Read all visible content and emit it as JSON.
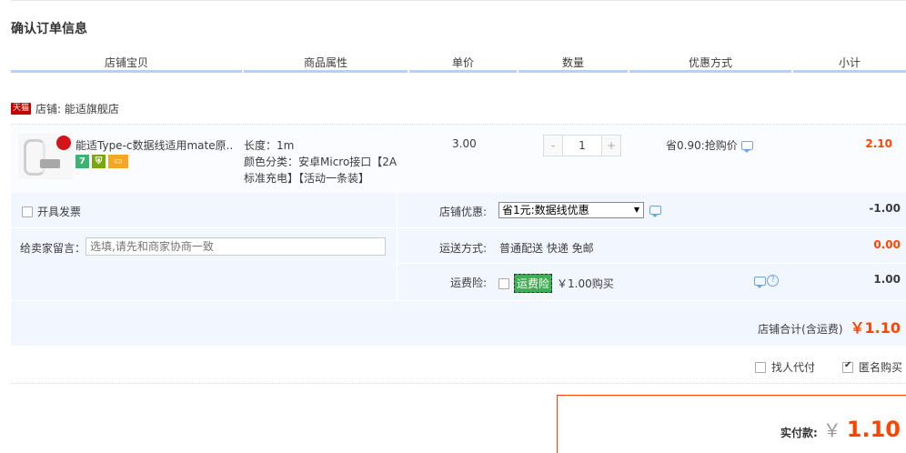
{
  "page": {
    "title": "确认订单信息"
  },
  "columns": [
    "店铺宝贝",
    "商品属性",
    "单价",
    "数量",
    "优惠方式",
    "小计"
  ],
  "store": {
    "badge": "天猫",
    "label": "店铺: 能适旗舰店"
  },
  "item": {
    "title": "能适Type-c数据线适用mate原...",
    "props": {
      "length": "长度：1m",
      "color_class": "颜色分类：安卓Micro接口【2A标准充电】【活动一条装】"
    },
    "unit_price": "3.00",
    "quantity": "1",
    "qty_minus": "-",
    "qty_plus": "+",
    "promo": "省0.90:抢购价",
    "subtotal": "2.10",
    "service_icons": [
      "7",
      "⛨",
      "▭"
    ]
  },
  "options": {
    "invoice_label": "开具发票",
    "message_label": "给卖家留言：",
    "message_placeholder": "选填,请先和商家协商一致",
    "store_discount_label": "店铺优惠:",
    "store_discount_selected": "省1元:数据线优惠",
    "store_discount_amount": "-1.00",
    "shipping_label": "运送方式:",
    "shipping_value": "普通配送 快递 免邮",
    "shipping_amount": "0.00",
    "insurance_label": "运费险:",
    "insurance_tag": "运费险",
    "insurance_price": "￥1.00购买",
    "insurance_amount": "1.00"
  },
  "store_total": {
    "label": "店铺合计(含运费)",
    "amount": "￥1.10"
  },
  "extras": {
    "proxy_pay_label": "找人代付",
    "anonymous_label": "匿名购买"
  },
  "payment": {
    "label": "实付款:",
    "currency": "￥",
    "amount": "1.10"
  },
  "colors": {
    "accent_red": "#ff4400",
    "header_underline": "#b2d1ff",
    "options_bg": "#f2f7ff"
  }
}
